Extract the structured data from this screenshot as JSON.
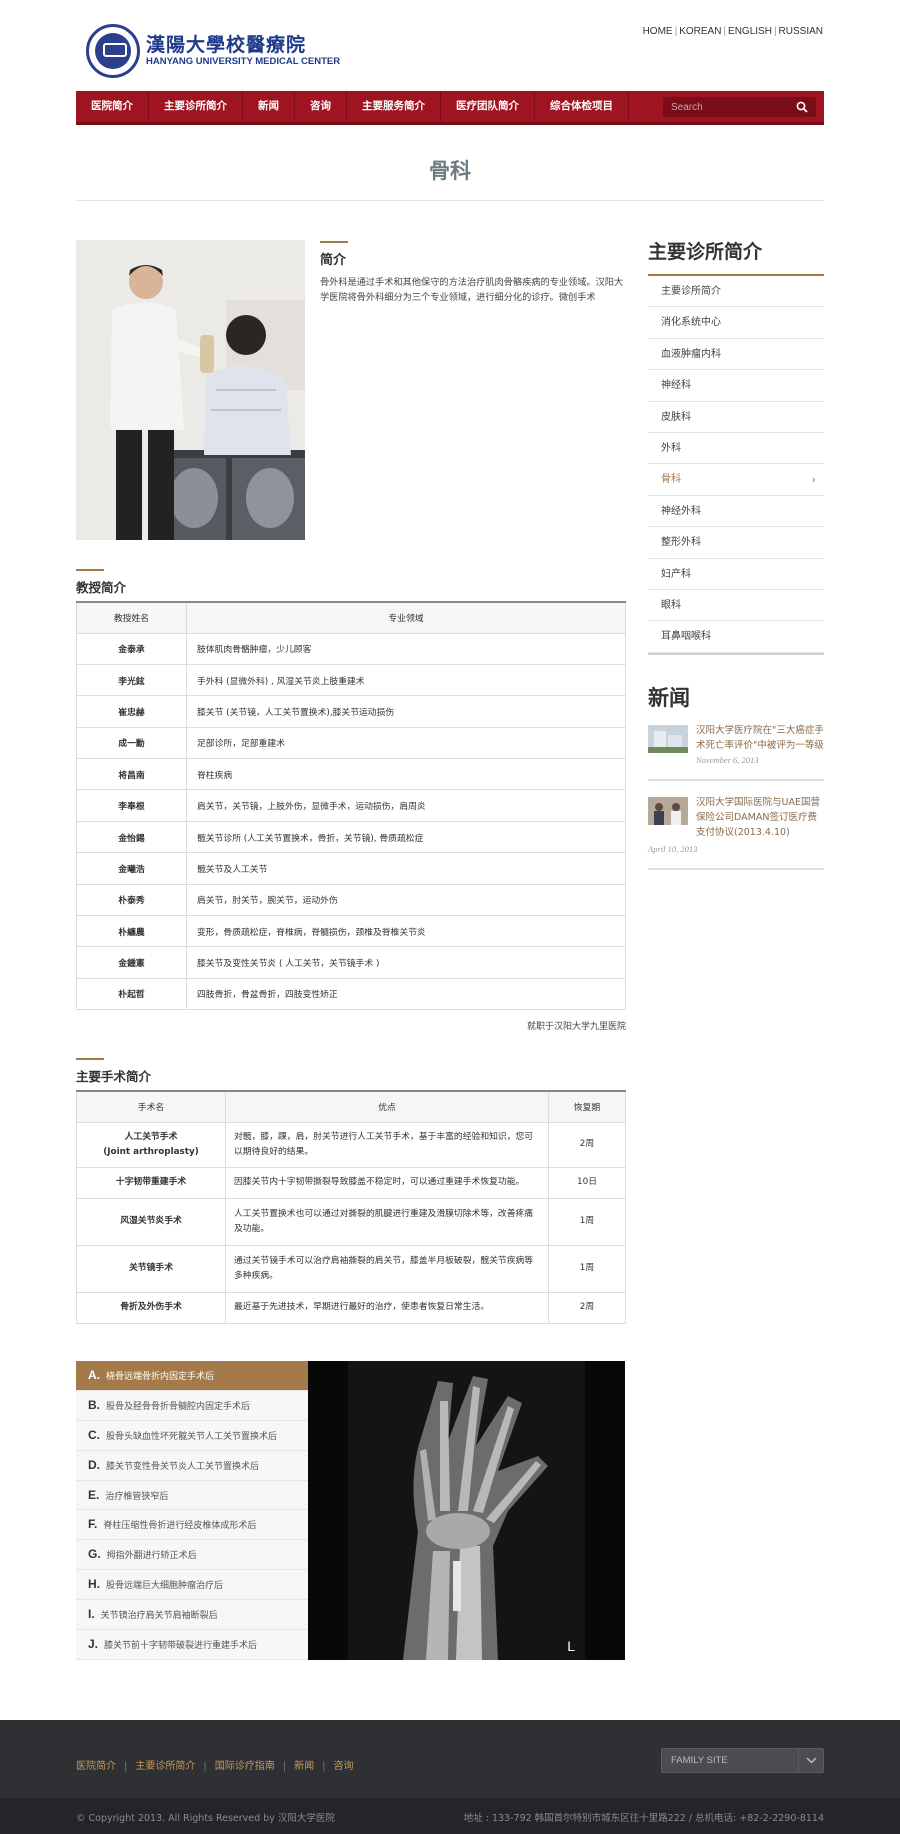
{
  "header": {
    "logo_text_ko": "漢陽大學校醫療院",
    "logo_text_en": "HANYANG UNIVERSITY MEDICAL CENTER",
    "lang_links": [
      "HOME",
      "KOREAN",
      "ENGLISH",
      "RUSSIAN"
    ]
  },
  "nav": {
    "items": [
      "医院简介",
      "主要诊所简介",
      "新闻",
      "咨询",
      "主要服务简介",
      "医疗团队简介",
      "综合体检项目"
    ],
    "search_placeholder": "Search"
  },
  "page": {
    "title": "骨科"
  },
  "intro": {
    "heading": "简介",
    "text": "骨外科是通过手术和其他保守的方法治疗肌肉骨骼疾病的专业领域。汉阳大学医院将骨外科细分为三个专业领域，进行细分化的诊疗。微创手术"
  },
  "professors": {
    "heading": "教授简介",
    "columns": [
      "教授姓名",
      "专业领域"
    ],
    "rows": [
      {
        "name": "金泰承",
        "field": "肢体肌肉骨骼肿瘤，少儿顾客"
      },
      {
        "name": "李光鉉",
        "field": "手外科 (显微外科) , 风湿关节炎上肢重建术"
      },
      {
        "name": "崔忠赫",
        "field": "膝关节 (关节镜，人工关节置换术),膝关节运动损伤"
      },
      {
        "name": "成一勳",
        "field": "足部诊所，足部重建术"
      },
      {
        "name": "将昌南",
        "field": "脊柱疾病"
      },
      {
        "name": "李奉根",
        "field": "肩关节，关节镜，上肢外伤，显微手术，运动损伤，肩周炎"
      },
      {
        "name": "金怡錫",
        "field": "髋关节诊所 (人工关节置换术，骨折，关节镜), 骨质疏松症"
      },
      {
        "name": "金曦浩",
        "field": "髋关节及人工关节"
      },
      {
        "name": "朴泰秀",
        "field": "肩关节，肘关节，腕关节，运动外伤"
      },
      {
        "name": "朴纏農",
        "field": "变形，骨质疏松症，脊椎病，脊髓损伤，颈椎及脊椎关节炎"
      },
      {
        "name": "金鍾憲",
        "field": "膝关节及变性关节炎 ( 人工关节，关节镜手术 )"
      },
      {
        "name": "朴起哲",
        "field": "四肢骨折，骨盆骨折，四肢变性矫正"
      }
    ],
    "note": "就职于汉阳大学九里医院"
  },
  "surgeries": {
    "heading": "主要手术简介",
    "columns": [
      "手术名",
      "优点",
      "恢复期"
    ],
    "rows": [
      {
        "name": "人工关节手术\n(Joint arthroplasty)",
        "desc": "对髋，膝，踝，肩，肘关节进行人工关节手术，基于丰富的经验和知识，您可以期待良好的结果。",
        "period": "2周"
      },
      {
        "name": "十字韧带重建手术",
        "desc": "因膝关节内十字韧带撕裂导致膝盖不稳定时，可以通过重建手术恢复功能。",
        "period": "10日"
      },
      {
        "name": "风湿关节炎手术",
        "desc": "人工关节置换术也可以通过对撕裂的肌腱进行重建及滑膜切除术等，改善疼痛及功能。",
        "period": "1周"
      },
      {
        "name": "关节镜手术",
        "desc": "通过关节镜手术可以治疗肩袖撕裂的肩关节，膝盖半月板破裂，髋关节疾病等多种疾病。",
        "period": "1周"
      },
      {
        "name": "骨折及外伤手术",
        "desc": "最近基于先进技术，早期进行最好的治疗，使患者恢复日常生活。",
        "period": "2周"
      }
    ]
  },
  "gallery": {
    "items": [
      {
        "letter": "A.",
        "label": "桡骨远端骨折内固定手术后"
      },
      {
        "letter": "B.",
        "label": "股骨及胫骨骨折骨髓腔内固定手术后"
      },
      {
        "letter": "C.",
        "label": "股骨头缺血性坏死髋关节人工关节置换术后"
      },
      {
        "letter": "D.",
        "label": "膝关节变性骨关节炎人工关节置换术后"
      },
      {
        "letter": "E.",
        "label": "治疗椎管狭窄后"
      },
      {
        "letter": "F.",
        "label": "脊柱压缩性骨折进行经皮椎体成形术后"
      },
      {
        "letter": "G.",
        "label": "拇指外翻进行矫正术后"
      },
      {
        "letter": "H.",
        "label": "股骨远端巨大细胞肿瘤治疗后"
      },
      {
        "letter": "I.",
        "label": "关节镜治疗肩关节肩袖断裂后"
      },
      {
        "letter": "J.",
        "label": "膝关节前十字韧带破裂进行重建手术后"
      }
    ],
    "active_index": 0,
    "xray_label": "L"
  },
  "sidebar": {
    "title": "主要诊所简介",
    "items": [
      "主要诊所简介",
      "消化系统中心",
      "血液肿瘤内科",
      "神经科",
      "皮肤科",
      "外科",
      "骨科",
      "神经外科",
      "整形外科",
      "妇产科",
      "眼科",
      "耳鼻咽喉科"
    ],
    "active_index": 6
  },
  "news": {
    "title": "新闻",
    "items": [
      {
        "text": "汉阳大学医疗院在\"三大癌症手术死亡率评价\"中被评为一等级",
        "date": "November 6, 2013"
      },
      {
        "text": "汉阳大学国际医院与UAE国营保险公司DAMAN签订医疗费支付协议(2013.4.10)",
        "date": "April 10, 2013"
      }
    ]
  },
  "footer": {
    "links": [
      "医院简介",
      "主要诊所简介",
      "国际诊疗指南",
      "新闻",
      "咨询"
    ],
    "family_site": "FAMILY SITE",
    "copyright": "© Copyright 2013. All Rights Reserved by 汉阳大学医院",
    "address": "地址 : 133-792 韩国首尔特别市城东区往十里路222 / 总机电话: +82-2-2290-8114"
  },
  "colors": {
    "nav_bg": "#9e1420",
    "accent": "#a47a4a",
    "logo_blue": "#1f3a8a",
    "footer_bg": "#2e3033",
    "footer_link": "#c69a5a"
  }
}
